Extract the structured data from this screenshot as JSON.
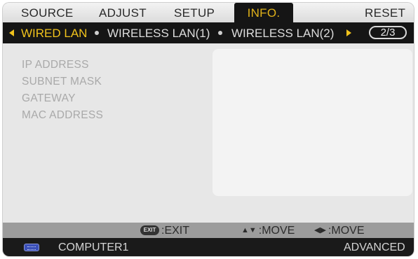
{
  "menu": {
    "items": [
      {
        "label": "SOURCE"
      },
      {
        "label": "ADJUST"
      },
      {
        "label": "SETUP"
      },
      {
        "label": "INFO."
      },
      {
        "label": "RESET"
      }
    ],
    "active_index": 3
  },
  "tabs": {
    "items": [
      {
        "label": "WIRED LAN"
      },
      {
        "label": "WIRELESS LAN(1)"
      },
      {
        "label": "WIRELESS LAN(2)"
      }
    ],
    "active_index": 0,
    "page_indicator": "2/3"
  },
  "info": {
    "fields": [
      {
        "label": "IP ADDRESS",
        "value": ""
      },
      {
        "label": "SUBNET MASK",
        "value": ""
      },
      {
        "label": "GATEWAY",
        "value": ""
      },
      {
        "label": "MAC ADDRESS",
        "value": ""
      }
    ]
  },
  "help": {
    "exit_icon_text": "EXIT",
    "exit": ":EXIT",
    "move_vertical": ":MOVE",
    "move_horizontal": ":MOVE"
  },
  "status": {
    "source_icon": "vga-connector-icon",
    "source": "COMPUTER1",
    "mode": "ADVANCED"
  },
  "colors": {
    "active_text": "#f0c21c",
    "tab_bar": "#151515",
    "panel": "#e7e7e7",
    "label_text": "#a9a9a9"
  }
}
